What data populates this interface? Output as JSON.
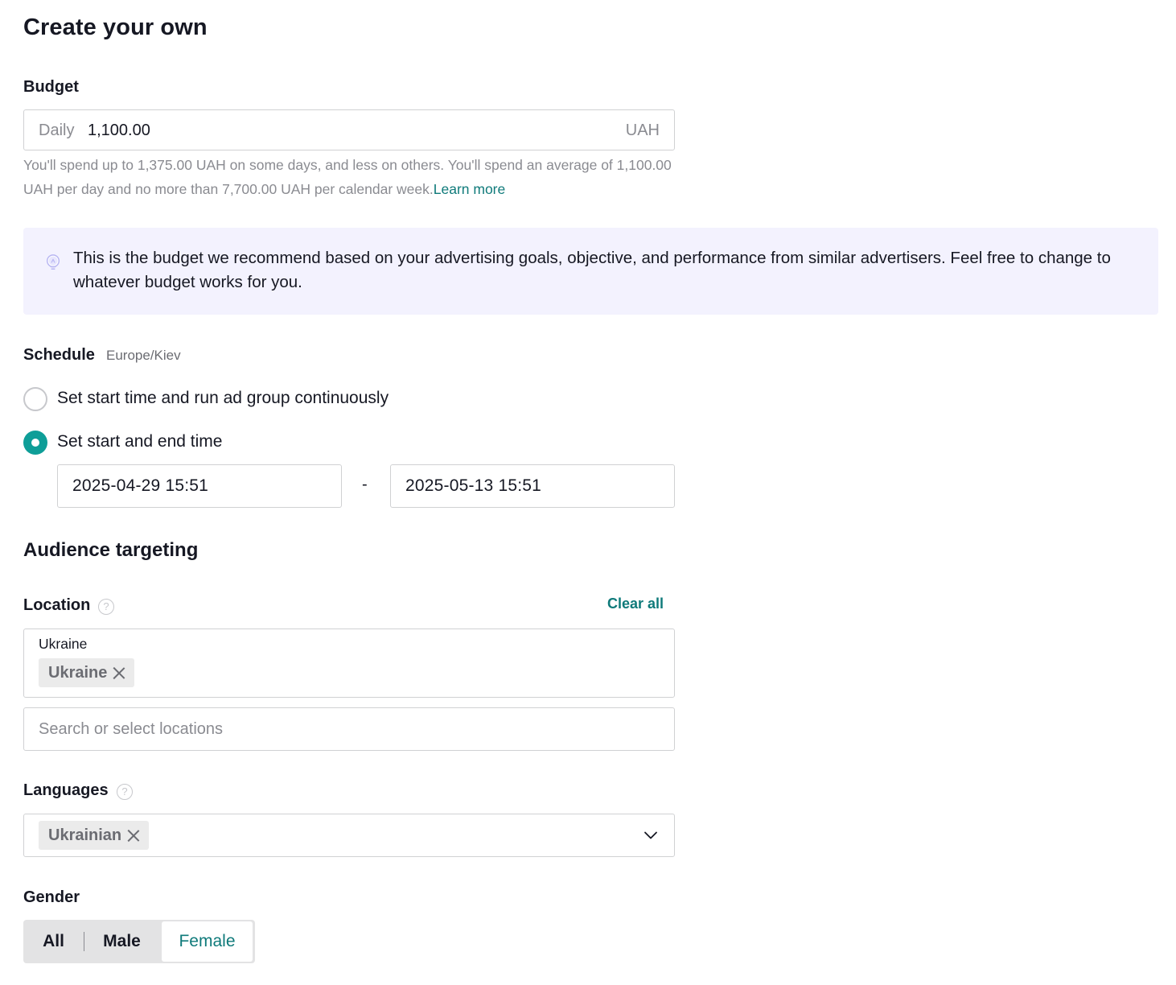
{
  "page": {
    "title": "Create your own"
  },
  "budget": {
    "label": "Budget",
    "mode": "Daily",
    "value": "1,100.00",
    "currency": "UAH",
    "helper_text": "You'll spend up to 1,375.00 UAH on some days, and less on others. You'll spend an average of 1,100.00 UAH per day and no more than 7,700.00 UAH per calendar week.",
    "learn_more": "Learn more"
  },
  "tip": {
    "icon": "lightbulb-icon",
    "text": "This is the budget we recommend based on your advertising goals, objective, and performance from similar advertisers. Feel free to change to whatever budget works for you."
  },
  "schedule": {
    "label": "Schedule",
    "timezone": "Europe/Kiev",
    "options": [
      {
        "label": "Set start time and run ad group continuously",
        "selected": false
      },
      {
        "label": "Set start and end time",
        "selected": true
      }
    ],
    "start": "2025-04-29 15:51",
    "separator": "-",
    "end": "2025-05-13 15:51"
  },
  "audience": {
    "title": "Audience targeting",
    "location": {
      "label": "Location",
      "help_icon": "question-icon",
      "clear_all": "Clear all",
      "group": "Ukraine",
      "tags": [
        "Ukraine"
      ],
      "search_placeholder": "Search or select locations"
    },
    "languages": {
      "label": "Languages",
      "help_icon": "question-icon",
      "tags": [
        "Ukrainian"
      ]
    },
    "gender": {
      "label": "Gender",
      "options": [
        "All",
        "Male",
        "Female"
      ],
      "selected": "Female"
    }
  },
  "colors": {
    "accent": "#0e9e98",
    "link": "#0f7a7a",
    "tip_bg": "#f3f2fe"
  }
}
